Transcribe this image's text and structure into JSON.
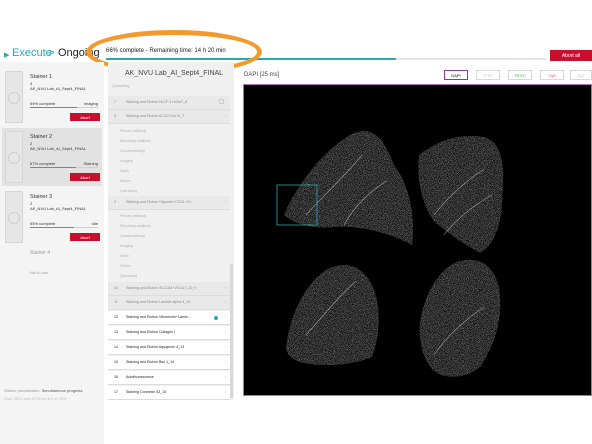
{
  "header": {
    "breadcrumb_execute": "Execute",
    "breadcrumb_sep": ">",
    "breadcrumb_current": "Ongoing",
    "progress_text": "66% complete - Remaining time: 14 h 20 min",
    "progress_fraction": 0.66,
    "abort_all_label": "Abort all"
  },
  "stainers": [
    {
      "name": "Stainer 1",
      "num": "4",
      "protocol": "AK_NVU Lab_AI_Sept4_FINAL",
      "pct": "69% complete",
      "state": "Imaging",
      "progress": 0.69,
      "abort": "Abort"
    },
    {
      "name": "Stainer 2",
      "num": "2",
      "protocol": "AK_NVU Lab_AI_Sept4_FINAL",
      "pct": "67% complete",
      "state": "Staining",
      "progress": 0.67,
      "abort": "Abort"
    },
    {
      "name": "Stainer 3",
      "num": "2",
      "protocol": "AK_NVU Lab_AI_Sept4_FINAL",
      "pct": "65% complete",
      "state": "Idle",
      "progress": 0.65,
      "abort": "Abort"
    },
    {
      "name": "Stainer 4",
      "state": "Not in use"
    }
  ],
  "footer": {
    "prio_label": "Stainer prioritization:",
    "prio_value": "Simultaneous progress",
    "cut_text": "Stop 5821 and 43 (from 4h) of 22%"
  },
  "steps_panel": {
    "title": "AK_NVU Lab_AI_Sept4_FINAL",
    "chevron": "›",
    "step_7_label": "Quenching",
    "steps": [
      {
        "n": "7",
        "label": "Staining and Elution HLCF-1+vGlaT_6"
      },
      {
        "n": "8",
        "label": "Staining and Elution ACC2+Col IV_7"
      },
      {
        "n": "9",
        "label": "Staining and Elution Calponin+CD31 / Ki..."
      },
      {
        "n": "10",
        "label": "Staining and Elution SLC1A4+VGLUT_10_9"
      },
      {
        "n": "11",
        "label": "Staining and Elution Laminin alpha 4_10"
      },
      {
        "n": "12",
        "label": "Staining and Elution Vitronectin+Lamin..."
      },
      {
        "n": "13",
        "label": "Staining and Elution Collagen I"
      },
      {
        "n": "14",
        "label": "Staining and Elution Aquaporin 4_13"
      },
      {
        "n": "15",
        "label": "Staining and Elution Bsn 1_14"
      },
      {
        "n": "16",
        "label": "Autofluorescence"
      },
      {
        "n": "17",
        "label": "Staining Connexin 43_15"
      }
    ],
    "substeps_a": [
      "Primary antibody",
      "Secondary antibody",
      "Counterstaining",
      "Imaging",
      "Wash",
      "Elution",
      "Quenching"
    ],
    "substeps_b": [
      "Primary antibody",
      "Secondary antibody",
      "Counterstaining",
      "Imaging",
      "Wash",
      "Elution",
      "Quenching"
    ]
  },
  "viewer": {
    "title": "DAPI [25 ms]",
    "channels": [
      "DAPI",
      "FITC",
      "TRITC",
      "Cy5",
      "Cy7"
    ],
    "channel_colors": [
      "#8a3ca1",
      "#cccccc",
      "#2ea84a",
      "#e05050",
      "#cccccc"
    ]
  }
}
